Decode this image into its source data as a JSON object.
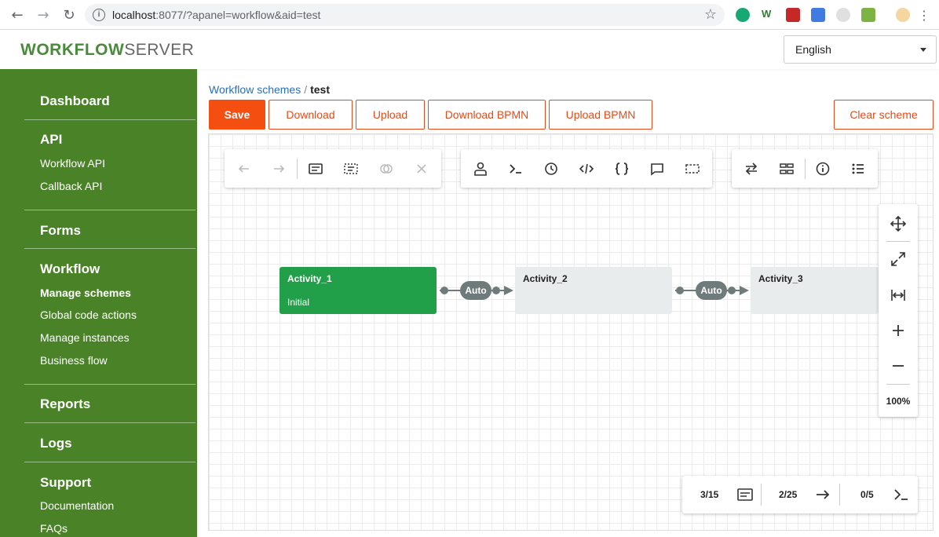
{
  "browser": {
    "url_host": "localhost",
    "url_rest": ":8077/?apanel=workflow&aid=test"
  },
  "header": {
    "logo_part1": "WORKFLOW",
    "logo_part2": "SERVER",
    "language": "English"
  },
  "sidebar": {
    "dashboard": "Dashboard",
    "api": "API",
    "api_items": [
      "Workflow API",
      "Callback API"
    ],
    "forms": "Forms",
    "workflow": "Workflow",
    "workflow_items": [
      "Manage schemes",
      "Global code actions",
      "Manage instances",
      "Business flow"
    ],
    "reports": "Reports",
    "logs": "Logs",
    "support": "Support",
    "support_items": [
      "Documentation",
      "FAQs"
    ]
  },
  "breadcrumb": {
    "parent": "Workflow schemes",
    "separator": "/",
    "current": "test"
  },
  "actions": {
    "save": "Save",
    "download": "Download",
    "upload": "Upload",
    "download_bpmn": "Download BPMN",
    "upload_bpmn": "Upload BPMN",
    "clear_scheme": "Clear scheme"
  },
  "diagram": {
    "activities": [
      {
        "name": "Activity_1",
        "state": "Initial"
      },
      {
        "name": "Activity_2",
        "state": ""
      },
      {
        "name": "Activity_3",
        "state": ""
      }
    ],
    "transitions": [
      {
        "label": "Auto"
      },
      {
        "label": "Auto"
      }
    ]
  },
  "zoom": {
    "level": "100%"
  },
  "status": {
    "activities": "3/15",
    "transitions": "2/25",
    "code": "0/5"
  },
  "colors": {
    "sidebar": "#4a8327",
    "accent": "#f44e11",
    "initial_activity": "#22a049",
    "connector": "#6f7b7b"
  }
}
